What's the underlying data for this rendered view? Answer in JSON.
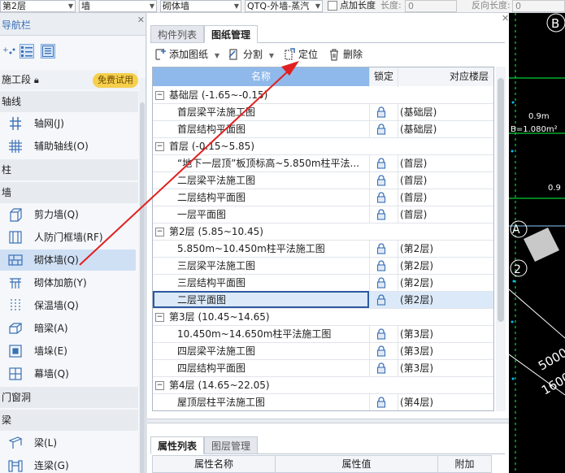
{
  "topbar": {
    "floor_value": "第2层",
    "category_value": "墙",
    "subtype_value": "砌体墙",
    "element_value": "QTQ-外墙-蒸汽",
    "point_length_label": "点加长度",
    "length_label": "长度:",
    "length_value": "0",
    "reverse_length_label": "反向长度:",
    "reverse_length_value": "0"
  },
  "nav": {
    "title": "导航栏",
    "construction_section": "施工段",
    "trial_badge": "免费试用",
    "groups": [
      {
        "label": "轴线",
        "items": [
          {
            "label": "轴网(J)",
            "icon": "grid-axis-icon"
          },
          {
            "label": "辅助轴线(O)",
            "icon": "aux-axis-icon"
          }
        ]
      },
      {
        "label": "柱",
        "items": []
      },
      {
        "label": "墙",
        "items": [
          {
            "label": "剪力墙(Q)",
            "icon": "shear-wall-icon"
          },
          {
            "label": "人防门框墙(RF)",
            "icon": "civil-defense-wall-icon"
          },
          {
            "label": "砌体墙(Q)",
            "icon": "masonry-wall-icon"
          },
          {
            "label": "砌体加筋(Y)",
            "icon": "masonry-rebar-icon"
          },
          {
            "label": "保温墙(Q)",
            "icon": "insulation-wall-icon"
          },
          {
            "label": "暗梁(A)",
            "icon": "hidden-beam-icon"
          },
          {
            "label": "墙垛(E)",
            "icon": "wall-pier-icon"
          },
          {
            "label": "幕墙(Q)",
            "icon": "curtain-wall-icon"
          }
        ]
      },
      {
        "label": "门窗洞",
        "items": []
      },
      {
        "label": "梁",
        "items": [
          {
            "label": "梁(L)",
            "icon": "beam-icon"
          },
          {
            "label": "连梁(G)",
            "icon": "coupling-beam-icon"
          }
        ]
      }
    ]
  },
  "panel": {
    "tabs": [
      "构件列表",
      "图纸管理"
    ],
    "active_tab": "图纸管理",
    "toolbar": {
      "add_drawing": "添加图纸",
      "split": "分割",
      "locate": "定位",
      "delete": "删除"
    },
    "columns": [
      "名称",
      "锁定",
      "对应楼层"
    ],
    "groups": [
      {
        "label": "基础层 (-1.65~-0.15)",
        "rows": [
          {
            "name": "首层梁平法施工图",
            "floor": "(基础层)"
          },
          {
            "name": "首层结构平面图",
            "floor": "(基础层)"
          }
        ]
      },
      {
        "label": "首层 (-0.15~5.85)",
        "rows": [
          {
            "name": "“地下一层顶”板顶标高~5.850m柱平法...",
            "floor": "(首层)"
          },
          {
            "name": "二层梁平法施工图",
            "floor": "(首层)"
          },
          {
            "name": "二层结构平面图",
            "floor": "(首层)"
          },
          {
            "name": "一层平面图",
            "floor": "(首层)"
          }
        ]
      },
      {
        "label": "第2层 (5.85~10.45)",
        "rows": [
          {
            "name": "5.850m~10.450m柱平法施工图",
            "floor": "(第2层)"
          },
          {
            "name": "三层梁平法施工图",
            "floor": "(第2层)"
          },
          {
            "name": "三层结构平面图",
            "floor": "(第2层)"
          },
          {
            "name": "二层平面图",
            "floor": "(第2层)"
          }
        ]
      },
      {
        "label": "第3层 (10.45~14.65)",
        "rows": [
          {
            "name": "10.450m~14.650m柱平法施工图",
            "floor": "(第3层)"
          },
          {
            "name": "四层梁平法施工图",
            "floor": "(第3层)"
          },
          {
            "name": "四层结构平面图",
            "floor": "(第3层)"
          }
        ]
      },
      {
        "label": "第4层 (14.65~22.05)",
        "rows": [
          {
            "name": "屋顶层柱平法施工图",
            "floor": "(第4层)"
          }
        ]
      }
    ],
    "expand_symbol": "−",
    "prop_tabs": [
      "属性列表",
      "图层管理"
    ],
    "prop_columns": [
      "属性名称",
      "属性值",
      "附加"
    ]
  },
  "cad": {
    "texts": [
      "B",
      "0.9m",
      "B=1.080m²",
      "0.9",
      "A",
      "2",
      "5000",
      "1600"
    ],
    "accent": "#00ff40"
  }
}
